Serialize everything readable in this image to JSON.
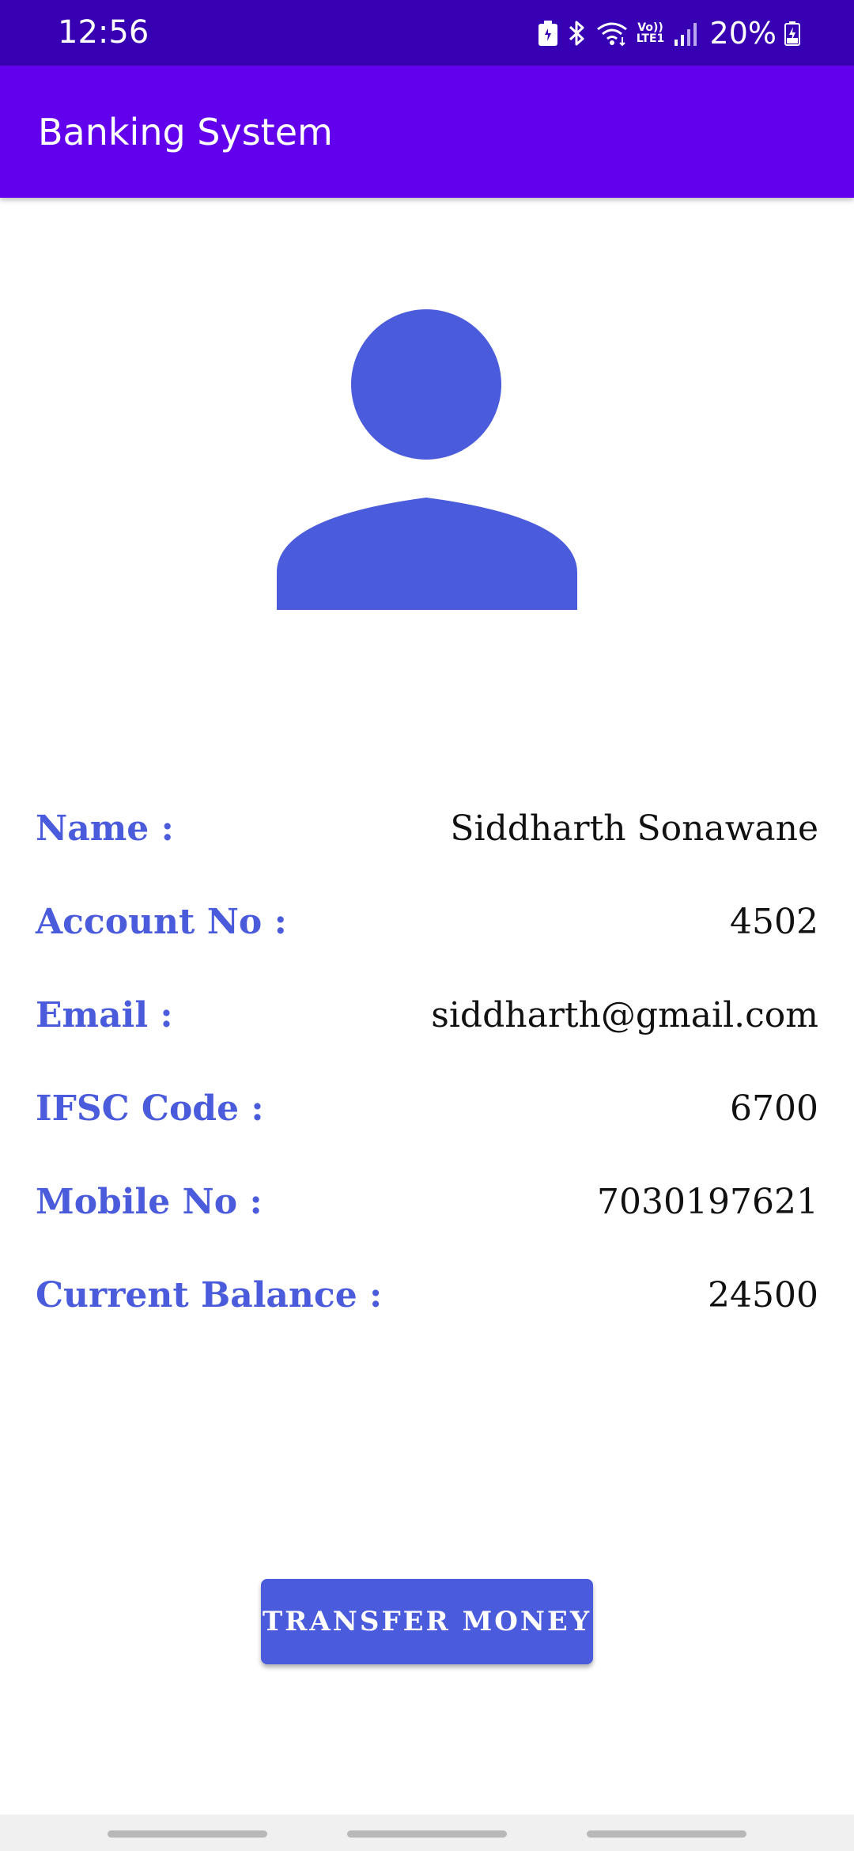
{
  "status_bar": {
    "time": "12:56",
    "battery_percent": "20%",
    "volte_label": "Vo)) LTE1",
    "icons": [
      "battery-saver-icon",
      "bluetooth-icon",
      "wifi-icon",
      "volte-icon",
      "signal-icon",
      "battery-charging-icon"
    ]
  },
  "app_bar": {
    "title": "Banking System",
    "color": "#6200ee"
  },
  "profile": {
    "avatar_icon": "person-icon",
    "avatar_color": "#4a5bdb"
  },
  "details": [
    {
      "label": "Name :",
      "value": "Siddharth Sonawane"
    },
    {
      "label": "Account No :",
      "value": "4502"
    },
    {
      "label": "Email :",
      "value": "siddharth@gmail.com"
    },
    {
      "label": "IFSC Code :",
      "value": "6700"
    },
    {
      "label": "Mobile No :",
      "value": "7030197621"
    },
    {
      "label": "Current Balance :",
      "value": "24500"
    }
  ],
  "actions": {
    "transfer_label": "TRANSFER MONEY",
    "accent": "#4a5bdb"
  }
}
